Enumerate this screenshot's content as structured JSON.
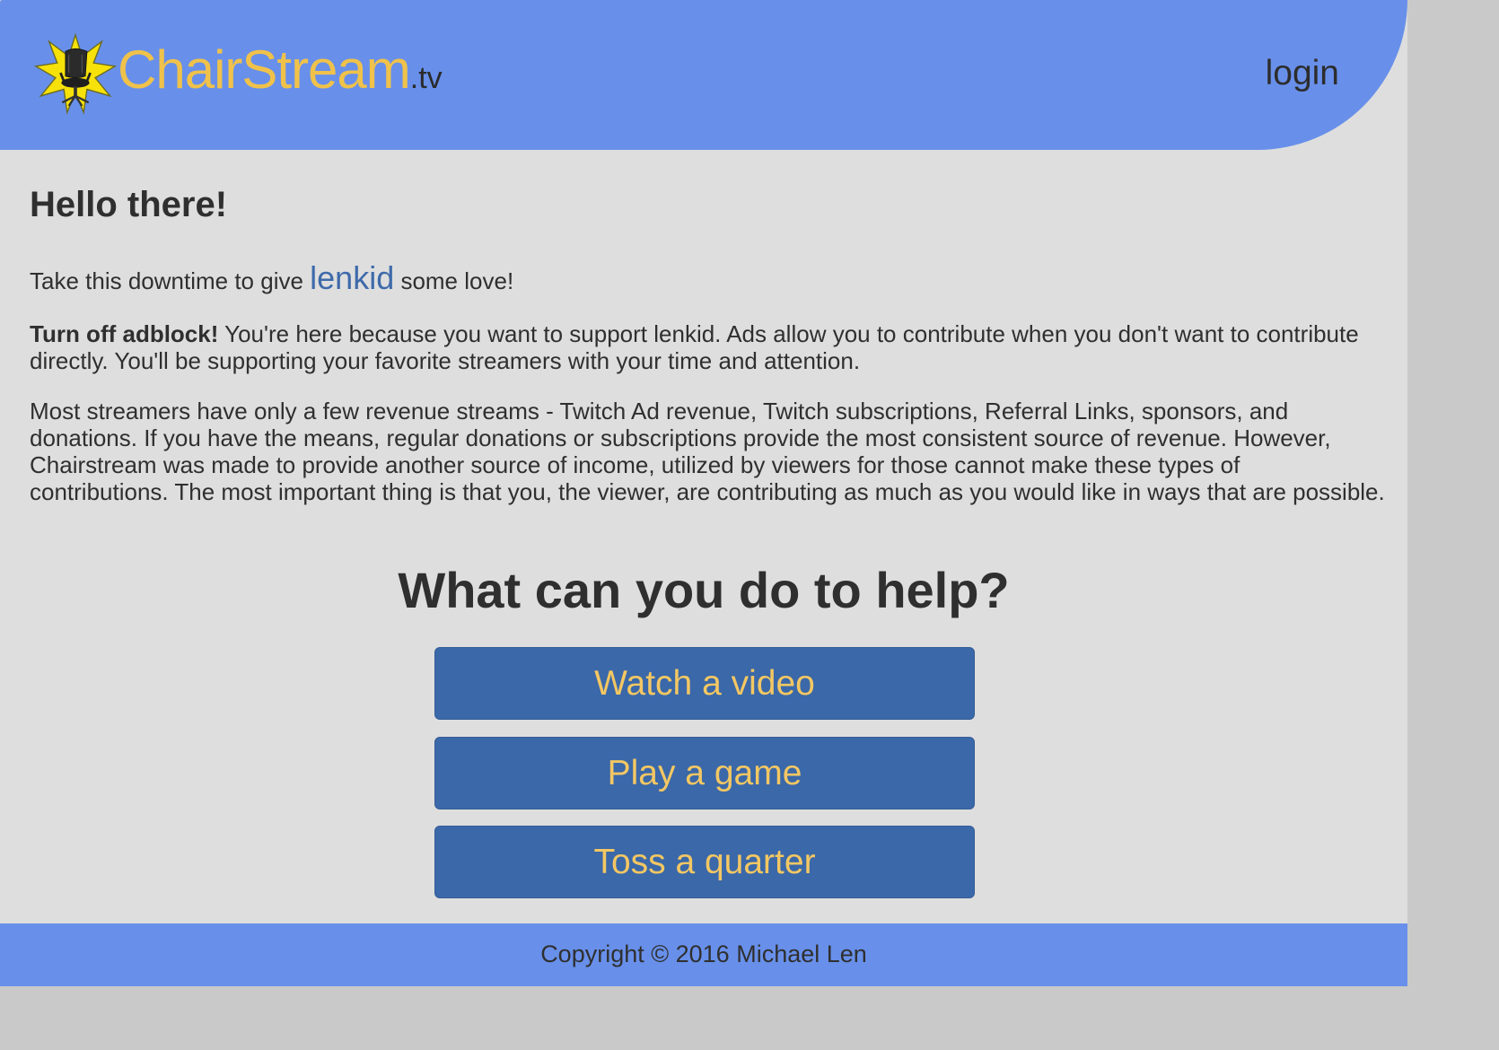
{
  "header": {
    "logo_name": "ChairStream",
    "logo_tld": ".tv",
    "logo_icon": "chair-star-icon",
    "login_label": "login"
  },
  "main": {
    "greeting": "Hello there!",
    "love_prefix": "Take this downtime to give ",
    "streamer_name": "lenkid",
    "love_suffix": " some love!",
    "adblock_strong": "Turn off adblock!",
    "adblock_text": " You're here because you want to support lenkid. Ads allow you to contribute when you don't want to contribute directly. You'll be supporting your favorite streamers with your time and attention.",
    "revenue_text": "Most streamers have only a few revenue streams - Twitch Ad revenue, Twitch subscriptions, Referral Links, sponsors, and donations. If you have the means, regular donations or subscriptions provide the most consistent source of revenue. However, Chairstream was made to provide another source of income, utilized by viewers for those cannot make these types of contributions. The most important thing is that you, the viewer, are contributing as much as you would like in ways that are possible.",
    "help_title": "What can you do to help?",
    "actions": [
      {
        "label": "Watch a video"
      },
      {
        "label": "Play a game"
      },
      {
        "label": "Toss a quarter"
      }
    ]
  },
  "footer": {
    "copyright": "Copyright © 2016 Michael Len"
  },
  "colors": {
    "header_bg": "#6890ea",
    "page_bg": "#dedede",
    "button_bg": "#3b68a8",
    "button_text": "#f3c763",
    "logo_text": "#f0c24a",
    "link": "#3e6aaa"
  }
}
